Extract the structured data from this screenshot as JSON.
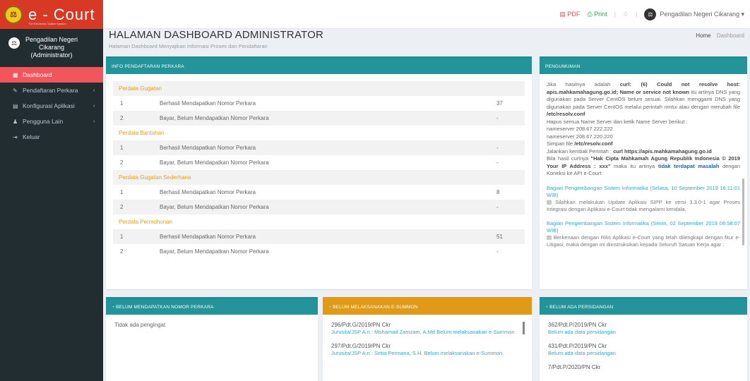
{
  "app": {
    "logo_text": "e - Court",
    "logo_sub": "The Electronic Justice System"
  },
  "topbar": {
    "pdf_label": "PDF",
    "print_label": "Print",
    "user_label": "Pengadilan Negeri Cikarang ▾"
  },
  "sidebar": {
    "user_line1": "Pengadilan Negeri",
    "user_line2": "Cikarang",
    "user_line3": "(Administrator)",
    "items": [
      {
        "label": "Dashboard",
        "icon": "▦",
        "caret": ""
      },
      {
        "label": "Pendaftaran Perkara",
        "icon": "✎",
        "caret": "‹"
      },
      {
        "label": "Konfigurasi Aplikasi",
        "icon": "▤",
        "caret": "‹"
      },
      {
        "label": "Pengguna Lain",
        "icon": "♟",
        "caret": "‹"
      },
      {
        "label": "Keluar",
        "icon": "⇥",
        "caret": ""
      }
    ]
  },
  "page": {
    "title": "HALAMAN DASHBOARD ADMINISTRATOR",
    "subtitle": "Halaman Dashboard Menyajikan Informasi Proses dan Pendaftaran",
    "breadcrumb_home": "Home",
    "breadcrumb_current": "Dashboard"
  },
  "info_box": {
    "header": "INFO PENDAFTARAN PERKARA",
    "sections": [
      {
        "title": "Perdata Gugatan",
        "rows": [
          {
            "no": "1",
            "label": "Berhasil Mendapatkan Nomor Perkara",
            "value": "37"
          },
          {
            "no": "2",
            "label": "Bayar, Belum Mendapatkan Nomor Perkara",
            "value": "-"
          }
        ]
      },
      {
        "title": "Perdata Bantahan",
        "rows": [
          {
            "no": "1",
            "label": "Berhasil Mendapatkan Nomor Perkara",
            "value": "-"
          },
          {
            "no": "2",
            "label": "Bayar, Belum Mendapatkan Nomor Perkara",
            "value": "-"
          }
        ]
      },
      {
        "title": "Perdata Gugatan Sederhana",
        "rows": [
          {
            "no": "1",
            "label": "Berhasil Mendapatkan Nomor Perkara",
            "value": "8"
          },
          {
            "no": "2",
            "label": "Bayar, Belum Mendapatkan Nomor Perkara",
            "value": "-"
          }
        ]
      },
      {
        "title": "Perdata Permohonan",
        "rows": [
          {
            "no": "1",
            "label": "Berhasil Mendapatkan Nomor Perkara",
            "value": "51"
          },
          {
            "no": "2",
            "label": "Bayar, Belum Mendapatkan Nomor Perkara",
            "value": "-"
          }
        ]
      }
    ]
  },
  "pengumuman": {
    "header": "PENGUMUMAN",
    "p1_a": "Jika hasilnya adalah",
    "p1_b": "curl: (6) Could not resolve host: apis.mahkamahagung.go.id; Name or service not known",
    "p1_c": "itu artinya DNS yang digunakan pada Server CentOS belum sesuai. Silahkan mengganti DNS yang digunakan pada Server CentOS melalui perintah ",
    "p1_d": "nmtui",
    "p1_e": " atau dengan merubah file ",
    "p1_f": "/etc/resolv.conf",
    "l1": "Hapus semua Name Server dan ketik Name Server berikut :",
    "l2": "nameserver 208.67.222.222",
    "l3": "nameserver 208.67.220.220",
    "l4a": "Simpan file ",
    "l4b": "/etc/resolv.conf",
    "l5a": "Jalankan kembali Perintah : ",
    "l5b": "curl https://apis.mahkamahagung.go.id",
    "l6a": "Bila hasil curlnya ",
    "l6b": "\"Hak Cipta Mahkamah Agung Republik Indonesia © 2019 Your IP Address : xxx\"",
    "l6c": " maka itu artinya ",
    "l6d": "tidak terdapat masalah",
    "l6e": " dengan Koneksi ke API e-Court",
    "news": [
      {
        "title": "Bagian Pengembangan Sistem Informatika (Selasa, 10 September 2019 16:11:01 WIB)",
        "body": "▤ Silahkan melakukan Update Aplikasi SIPP ke versi 3.3.0-1 agar Proses Integrasi dengan Aplikasi e-Court tidak mengalami kendala."
      },
      {
        "title": "Bagian Pengembangan Sistem Informatika (Senin, 02 September 2019 08:58:07 WIB)",
        "body": "▤ Berkenaan dengan Rilis Aplikasi e-Court yang telah dilengkapi dengan fitur e-Litigasi, maka dengan ini diinstruksikan kepada Seluruh Satuan Kerja agar :"
      }
    ]
  },
  "box_nomor": {
    "header": "◔ BELUM MENDAPATKAN NOMOR PERKARA",
    "empty": "Tidak ada pengingat"
  },
  "box_summon": {
    "header": "◔ BELUM MELAKSANAKAN e-SUMMON",
    "items": [
      {
        "case": "296/Pdt.G/2019/PN Ckr",
        "desc": "Jurusita/JSP A.n : Mohamad Zamzam, A.Md Belum melaksanakan e-Summon"
      },
      {
        "case": "297/Pdt.G/2019/PN Ckr",
        "desc": "Jurusita/JSP A.n : Setia Permana, S.H. Belum melaksanakan e-Summon"
      }
    ]
  },
  "box_sidang": {
    "header": "◔ BELUM ADA PERSIDANGAN",
    "items": [
      {
        "case": "362/Pdt.P/2019/PN Ckr",
        "desc": "Belum ada data persidangan"
      },
      {
        "case": "431/Pdt.P/2019/PN Ckr",
        "desc": "Belum ada data persidangan"
      },
      {
        "case": "7/Pdt.P/2020/PN Ckr",
        "desc": ""
      }
    ]
  }
}
